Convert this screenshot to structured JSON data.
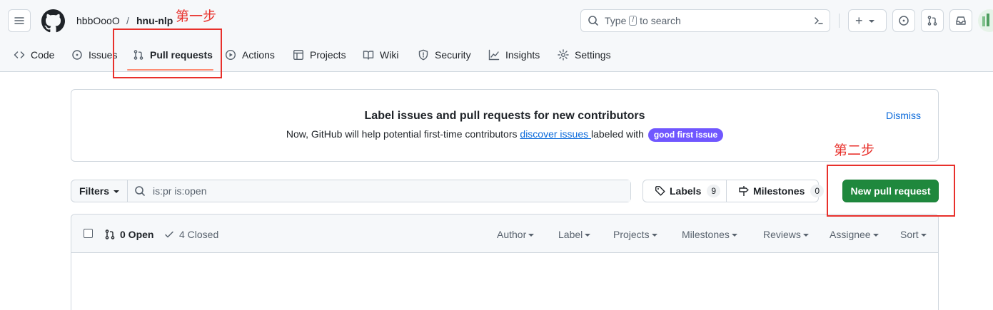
{
  "header": {
    "owner": "hbbOooO",
    "separator": "/",
    "repo": "hnu-nlp",
    "search": {
      "prefix": "Type",
      "key": "/",
      "suffix": "to search"
    },
    "plus_label": "+"
  },
  "nav": {
    "items": [
      {
        "label": "Code",
        "icon": "code-icon"
      },
      {
        "label": "Issues",
        "icon": "issue-opened-icon"
      },
      {
        "label": "Pull requests",
        "icon": "git-pull-request-icon",
        "selected": true
      },
      {
        "label": "Actions",
        "icon": "play-icon"
      },
      {
        "label": "Projects",
        "icon": "table-icon"
      },
      {
        "label": "Wiki",
        "icon": "book-icon"
      },
      {
        "label": "Security",
        "icon": "shield-icon"
      },
      {
        "label": "Insights",
        "icon": "graph-icon"
      },
      {
        "label": "Settings",
        "icon": "gear-icon"
      }
    ]
  },
  "banner": {
    "title": "Label issues and pull requests for new contributors",
    "text_before": "Now, GitHub will help potential first-time contributors ",
    "link": "discover issues ",
    "text_after": " labeled with ",
    "label": "good first issue",
    "label_color": "#7057ff",
    "dismiss": "Dismiss"
  },
  "filter": {
    "button": "Filters",
    "query": "is:pr is:open"
  },
  "labels": {
    "label": "Labels",
    "count": "9"
  },
  "milestones": {
    "label": "Milestones",
    "count": "0"
  },
  "new_pr": {
    "label": "New pull request",
    "color": "#1f883d"
  },
  "list": {
    "open": "0 Open",
    "closed": "4 Closed",
    "sorts": [
      "Author",
      "Label",
      "Projects",
      "Milestones",
      "Reviews",
      "Assignee",
      "Sort"
    ]
  },
  "annotations": {
    "step1": "第一步",
    "step2": "第二步",
    "color": "#e8302b"
  }
}
